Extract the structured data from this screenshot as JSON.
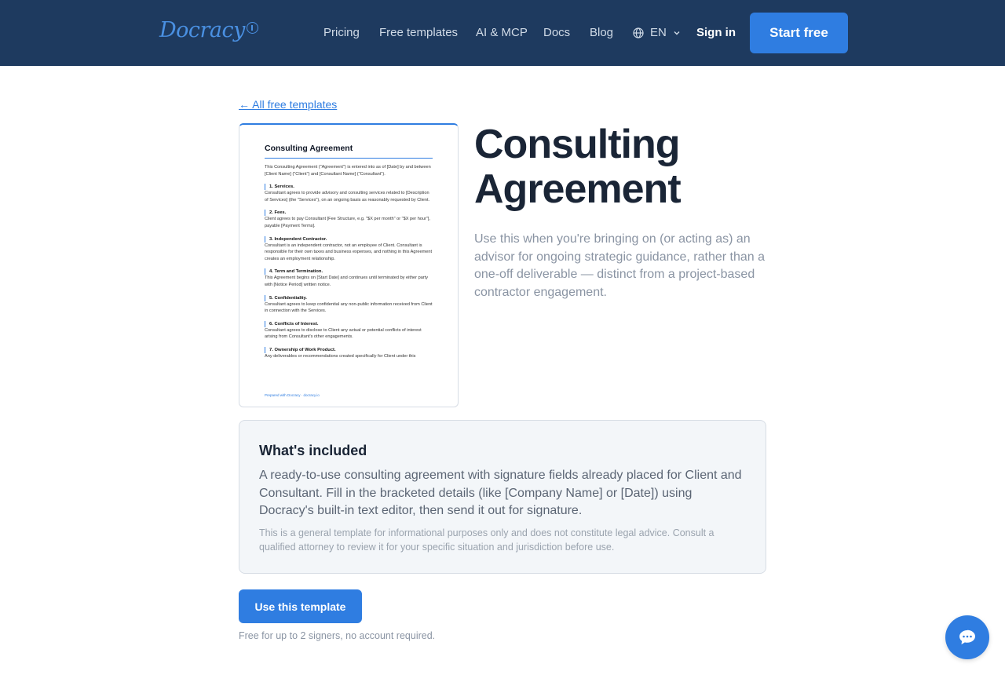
{
  "header": {
    "logo_text": "Docracy",
    "nav": [
      "Pricing",
      "Free templates",
      "AI & MCP",
      "Docs",
      "Blog"
    ],
    "language": "EN",
    "sign_in": "Sign in",
    "start_free": "Start free"
  },
  "back_link": "← All free templates",
  "preview": {
    "title": "Consulting Agreement",
    "intro": "This Consulting Agreement (\"Agreement\") is entered into as of [Date] by and between [Client Name] (\"Client\") and [Consultant Name] (\"Consultant\").",
    "sections": [
      {
        "heading": "1. Services.",
        "body": "Consultant agrees to provide advisory and consulting services related to [Description of Services] (the \"Services\"), on an ongoing basis as reasonably requested by Client."
      },
      {
        "heading": "2. Fees.",
        "body": "Client agrees to pay Consultant [Fee Structure, e.g. \"$X per month\" or \"$X per hour\"], payable [Payment Terms]."
      },
      {
        "heading": "3. Independent Contractor.",
        "body": "Consultant is an independent contractor, not an employee of Client. Consultant is responsible for their own taxes and business expenses, and nothing in this Agreement creates an employment relationship."
      },
      {
        "heading": "4. Term and Termination.",
        "body": "This Agreement begins on [Start Date] and continues until terminated by either party with [Notice Period] written notice."
      },
      {
        "heading": "5. Confidentiality.",
        "body": "Consultant agrees to keep confidential any non-public information received from Client in connection with the Services."
      },
      {
        "heading": "6. Conflicts of Interest.",
        "body": "Consultant agrees to disclose to Client any actual or potential conflicts of interest arising from Consultant's other engagements."
      },
      {
        "heading": "7. Ownership of Work Product.",
        "body": "Any deliverables or recommendations created specifically for Client under this"
      }
    ],
    "footer": "Prepared with Docracy · docracy.io"
  },
  "main": {
    "title": "Consulting Agreement",
    "description": "Use this when you're bringing on (or acting as) an advisor for ongoing strategic guidance, rather than a one-off deliverable — distinct from a project-based contractor engagement."
  },
  "included": {
    "heading": "What's included",
    "body": "A ready-to-use consulting agreement with signature fields already placed for Client and Consultant. Fill in the bracketed details (like [Company Name] or [Date]) using Docracy's built-in text editor, then send it out for signature.",
    "disclaimer": "This is a general template for informational purposes only and does not constitute legal advice. Consult a qualified attorney to review it for your specific situation and jurisdiction before use."
  },
  "cta": {
    "button": "Use this template",
    "note": "Free for up to 2 signers, no account required."
  },
  "colors": {
    "header_bg": "#1e3a5f",
    "accent": "#2f7de1"
  }
}
